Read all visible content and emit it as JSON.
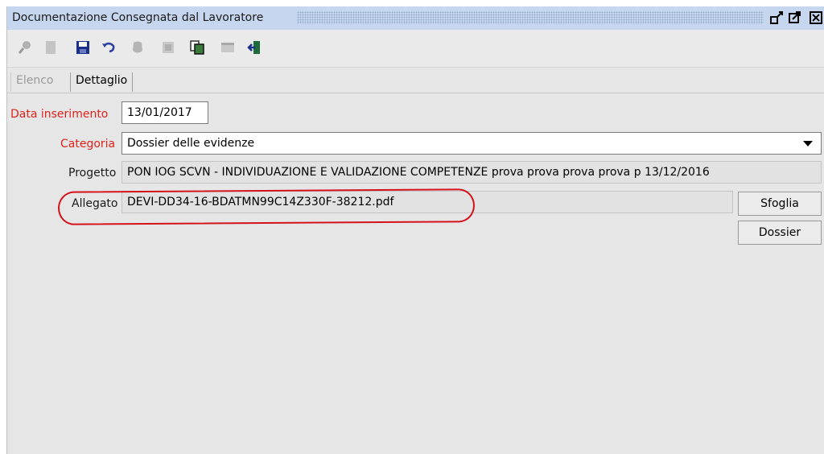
{
  "window": {
    "title": "Documentazione Consegnata dal Lavoratore",
    "buttons": [
      "restore-icon",
      "maximize-icon",
      "close-icon"
    ]
  },
  "toolbar": {
    "icons": [
      "search-icon",
      "new-document-icon",
      "save-icon",
      "undo-icon",
      "delete-icon",
      "print-icon",
      "copy-icon",
      "table-icon",
      "exit-icon"
    ]
  },
  "tabs": [
    {
      "label": "Elenco",
      "active": false
    },
    {
      "label": "Dettaglio",
      "active": true
    }
  ],
  "form": {
    "data_inserimento": {
      "label": "Data inserimento",
      "value": "13/01/2017"
    },
    "categoria": {
      "label": "Categoria",
      "value": "Dossier delle evidenze"
    },
    "progetto": {
      "label": "Progetto",
      "value": "PON IOG SCVN - INDIVIDUAZIONE E VALIDAZIONE COMPETENZE prova prova prova prova p 13/12/2016"
    },
    "allegato": {
      "label": "Allegato",
      "value": "DEVI-DD34-16-BDATMN99C14Z330F-38212.pdf"
    }
  },
  "buttons": {
    "sfoglia": "Sfoglia",
    "dossier": "Dossier"
  },
  "colors": {
    "title_bar": "#c5d6ee",
    "required_label": "#e0221c",
    "highlight": "#d5121b",
    "panel": "#e6e6e6"
  }
}
